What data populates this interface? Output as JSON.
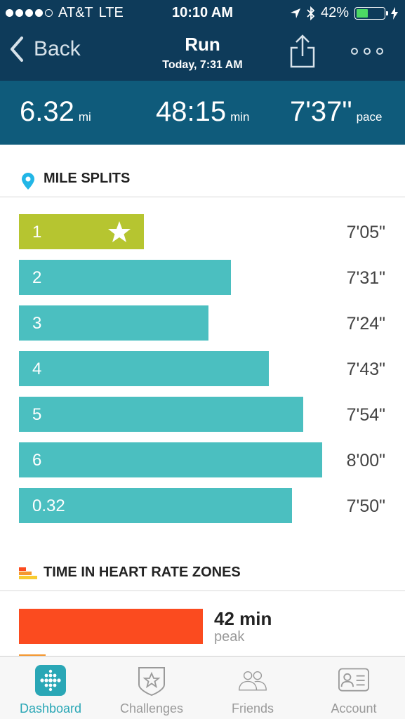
{
  "status_bar": {
    "carrier": "AT&T",
    "network": "LTE",
    "time": "10:10 AM",
    "battery": "42%",
    "battery_level": 0.42,
    "signal_bars": 4,
    "signal_total": 5
  },
  "nav": {
    "back_label": "Back",
    "title": "Run",
    "subtitle": "Today, 7:31 AM"
  },
  "summary": {
    "distance": "6.32",
    "distance_unit": "mi",
    "duration": "48:15",
    "duration_unit": "min",
    "pace": "7'37\"",
    "pace_unit": "pace"
  },
  "mile_splits": {
    "title": "MILE SPLITS",
    "splits": [
      {
        "label": "1",
        "time": "7'05\"",
        "bar_fraction": 0.33,
        "best": true
      },
      {
        "label": "2",
        "time": "7'31\"",
        "bar_fraction": 0.56,
        "best": false
      },
      {
        "label": "3",
        "time": "7'24\"",
        "bar_fraction": 0.5,
        "best": false
      },
      {
        "label": "4",
        "time": "7'43\"",
        "bar_fraction": 0.66,
        "best": false
      },
      {
        "label": "5",
        "time": "7'54\"",
        "bar_fraction": 0.75,
        "best": false
      },
      {
        "label": "6",
        "time": "8'00\"",
        "bar_fraction": 0.8,
        "best": false
      },
      {
        "label": "0.32",
        "time": "7'50\"",
        "bar_fraction": 0.72,
        "best": false
      }
    ]
  },
  "heart_rate": {
    "title": "TIME IN HEART RATE ZONES",
    "zones": [
      {
        "value": "42 min",
        "label": "peak",
        "color": "#fb4b1f"
      }
    ]
  },
  "tabs": [
    {
      "label": "Dashboard",
      "icon": "dashboard-icon",
      "active": true
    },
    {
      "label": "Challenges",
      "icon": "challenges-icon",
      "active": false
    },
    {
      "label": "Friends",
      "icon": "friends-icon",
      "active": false
    },
    {
      "label": "Account",
      "icon": "account-icon",
      "active": false
    }
  ],
  "colors": {
    "header_dark": "#0e3b5a",
    "stats_band": "#0f5b7b",
    "split_bar": "#4bbfc0",
    "best_split_bar": "#b6c530",
    "accent": "#2aa7b6"
  }
}
